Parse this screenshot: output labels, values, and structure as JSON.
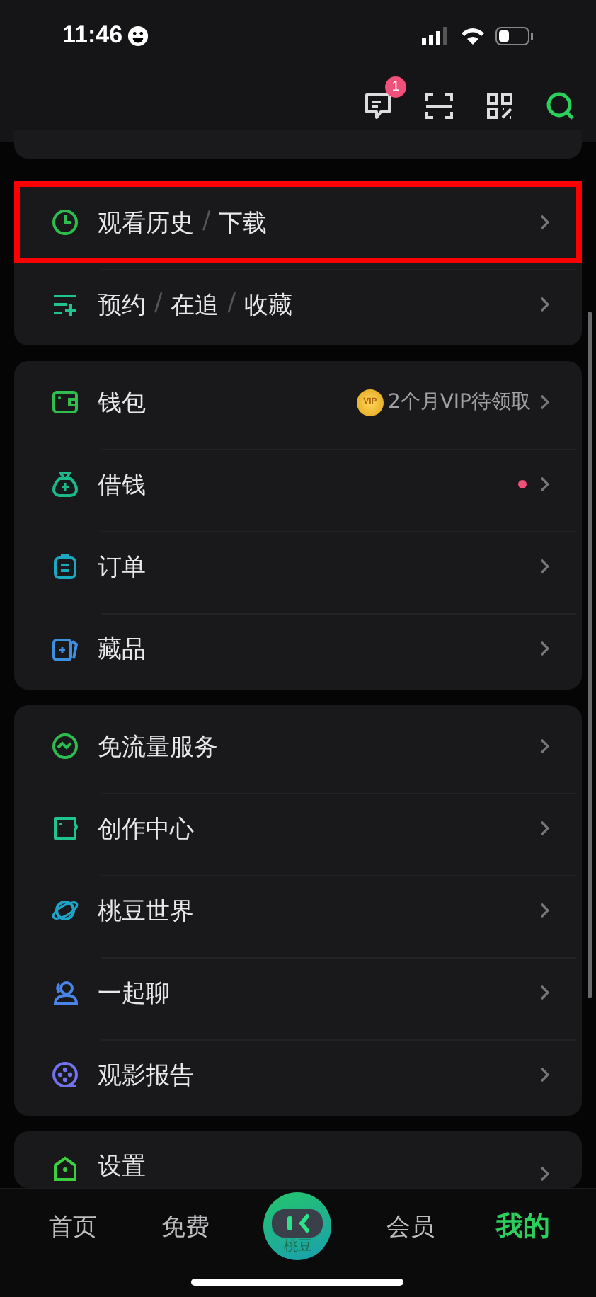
{
  "status_bar": {
    "time": "11:46"
  },
  "header_actions": [
    {
      "kind": "messages",
      "badge": "1"
    },
    {
      "kind": "scan"
    },
    {
      "kind": "qr"
    },
    {
      "kind": "search"
    }
  ],
  "cards": [
    {
      "rows": [
        {
          "kind": "clock",
          "color": "#2dbd4e",
          "label_parts": [
            "观看历史",
            "/",
            "下载"
          ],
          "highlighted": true,
          "dot": false
        },
        {
          "kind": "list-add",
          "color": "#1fc48e",
          "label_parts": [
            "预约",
            "/",
            "在追",
            "/",
            "收藏"
          ],
          "highlighted": false,
          "dot": false
        }
      ]
    },
    {
      "rows": [
        {
          "kind": "wallet",
          "color": "#2fbf4f",
          "label_parts": [
            "钱包"
          ],
          "value": "2个月VIP待领取",
          "value_coin": "VIP",
          "highlighted": false,
          "dot": false
        },
        {
          "kind": "moneybag",
          "color": "#19b98a",
          "label_parts": [
            "借钱"
          ],
          "highlighted": false,
          "dot": true
        },
        {
          "kind": "clipboard",
          "color": "#1aa9c0",
          "label_parts": [
            "订单"
          ],
          "highlighted": false,
          "dot": false
        },
        {
          "kind": "cards",
          "color": "#3d8fe0",
          "label_parts": [
            "藏品"
          ],
          "highlighted": false,
          "dot": false
        }
      ]
    },
    {
      "rows": [
        {
          "kind": "pulse",
          "color": "#2dbd4e",
          "label_parts": [
            "免流量服务"
          ],
          "highlighted": false,
          "dot": false
        },
        {
          "kind": "folder",
          "color": "#1fc48e",
          "label_parts": [
            "创作中心"
          ],
          "highlighted": false,
          "dot": false
        },
        {
          "kind": "planet",
          "color": "#1fa3c8",
          "label_parts": [
            "桃豆世界"
          ],
          "highlighted": false,
          "dot": false
        },
        {
          "kind": "people",
          "color": "#4a84e6",
          "label_parts": [
            "一起聊"
          ],
          "highlighted": false,
          "dot": false
        },
        {
          "kind": "film",
          "color": "#7173ee",
          "label_parts": [
            "观影报告"
          ],
          "highlighted": false,
          "dot": false
        }
      ]
    },
    {
      "rows": [
        {
          "kind": "house",
          "color": "#3ccf40",
          "label_parts": [
            "设置"
          ],
          "highlighted": false,
          "dot": false
        }
      ]
    }
  ],
  "tab_bar": {
    "tabs": [
      {
        "kind": "text",
        "label": "首页",
        "selected": false
      },
      {
        "kind": "text",
        "label": "免费",
        "selected": false
      },
      {
        "kind": "mascot",
        "label": "桃豆",
        "selected": false
      },
      {
        "kind": "text",
        "label": "会员",
        "selected": false
      },
      {
        "kind": "text",
        "label": "我的",
        "selected": true
      }
    ]
  }
}
